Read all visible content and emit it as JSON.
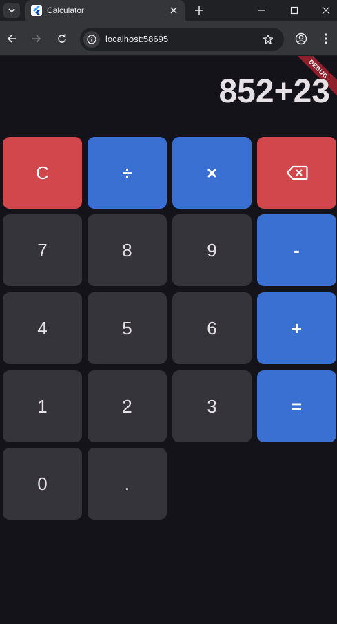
{
  "browser": {
    "tab_title": "Calculator",
    "url": "localhost:58695"
  },
  "app": {
    "debug_label": "DEBUG",
    "display": "852+23",
    "keys": {
      "clear": "C",
      "divide": "÷",
      "multiply": "×",
      "seven": "7",
      "eight": "8",
      "nine": "9",
      "minus": "-",
      "four": "4",
      "five": "5",
      "six": "6",
      "plus": "+",
      "one": "1",
      "two": "2",
      "three": "3",
      "equals": "=",
      "zero": "0",
      "dot": "."
    }
  },
  "colors": {
    "background": "#15131a",
    "number_key": "#36343b",
    "operator_key": "#3a70d1",
    "danger_key": "#d1474b",
    "debug_banner": "#8f1f2a"
  },
  "icons": {
    "backspace": "backspace-icon"
  }
}
